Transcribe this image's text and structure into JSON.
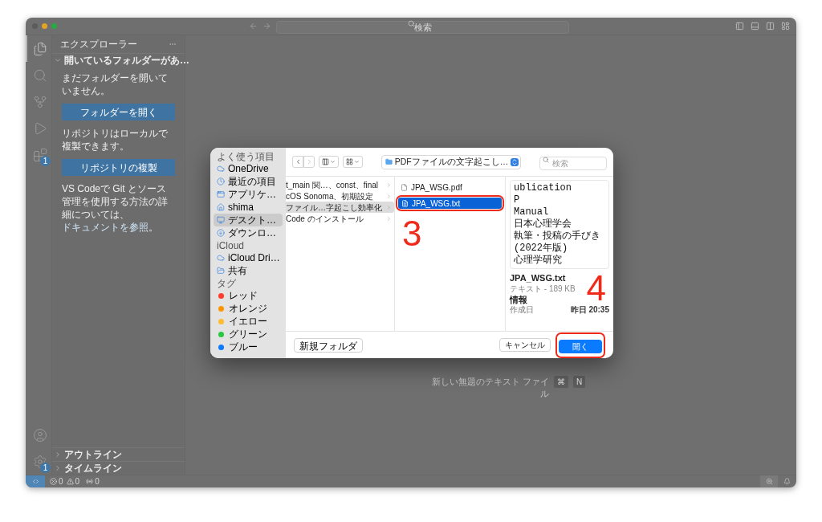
{
  "titlebar": {
    "search_placeholder": "検索"
  },
  "activity_bar": {
    "items": [
      {
        "kind": "explorer",
        "selected": true
      },
      {
        "kind": "search",
        "selected": false
      },
      {
        "kind": "source-control",
        "selected": false
      },
      {
        "kind": "run",
        "selected": false
      },
      {
        "kind": "extensions",
        "selected": false,
        "badge": "1"
      }
    ],
    "bottom": [
      {
        "kind": "account"
      },
      {
        "kind": "settings",
        "badge": "1"
      }
    ]
  },
  "sidebar": {
    "title": "エクスプローラー",
    "section": {
      "title": "開いているフォルダーがあ…",
      "expanded": true
    },
    "message_1": "まだフォルダーを開いていません。",
    "open_folder_button": "フォルダーを開く",
    "message_2": "リポジトリはローカルで複製できます。",
    "clone_button": "リポジトリの複製",
    "message_3": "VS Codeで Git とソース管理を使用する方法の詳細については、",
    "docs_link": "ドキュメントを参照",
    "message_3_end": "。",
    "bottom_sections": [
      {
        "title": "アウトライン",
        "expanded": false
      },
      {
        "title": "タイムライン",
        "expanded": false
      }
    ]
  },
  "editor": {
    "hint": {
      "label": "新しい無題のテキスト ファイル",
      "keys": [
        "⌘",
        "N"
      ]
    }
  },
  "status_bar": {
    "errors": "0",
    "warnings": "0",
    "ports": "0"
  },
  "dialog": {
    "sidebar": [
      {
        "title": "よく使う項目",
        "items": [
          {
            "kind": "cloud",
            "label": "OneDrive",
            "selected": false
          },
          {
            "kind": "clock",
            "label": "最近の項目",
            "selected": false
          },
          {
            "kind": "apps",
            "label": "アプリケ…",
            "selected": false
          },
          {
            "kind": "home",
            "label": "shima",
            "selected": false
          },
          {
            "kind": "desktop",
            "label": "デスクト…",
            "selected": true
          },
          {
            "kind": "download",
            "label": "ダウンロ…",
            "selected": false
          }
        ]
      },
      {
        "title": "iCloud",
        "items": [
          {
            "kind": "cloud",
            "label": "iCloud Dri…",
            "selected": false
          },
          {
            "kind": "shared",
            "label": "共有",
            "selected": false
          }
        ]
      },
      {
        "title": "タグ",
        "items": [
          {
            "kind": "tag",
            "label": "レッド",
            "color": "#ff3b30",
            "selected": false
          },
          {
            "kind": "tag",
            "label": "オレンジ",
            "color": "#ff9500",
            "selected": false
          },
          {
            "kind": "tag",
            "label": "イエロー",
            "color": "#febc2e",
            "selected": false
          },
          {
            "kind": "tag",
            "label": "グリーン",
            "color": "#28c840",
            "selected": false
          },
          {
            "kind": "tag",
            "label": "ブルー",
            "color": "#0a7aff",
            "selected": false
          }
        ]
      }
    ],
    "location": "PDFファイルの文字起こし…",
    "search_placeholder": "検索",
    "folders": [
      {
        "label": "t_main 関…、const、final",
        "selected": false
      },
      {
        "label": "cOS Sonoma、初期設定",
        "selected": false
      },
      {
        "label": "ファイル…字起こし効率化",
        "selected": true
      },
      {
        "label": "Code のインストール",
        "selected": false
      }
    ],
    "files": [
      {
        "kind": "pdf",
        "label": "JPA_WSG.pdf",
        "selected": false,
        "circled": false
      },
      {
        "kind": "text",
        "label": "JPA_WSG.txt",
        "selected": true,
        "circled": true
      }
    ],
    "file_annotation": "3",
    "preview_lines": [
      "ublication",
      "P",
      "Manual",
      "日本心理学会",
      "執筆・投稿の手びき",
      "(2022年版)",
      "心理学研究"
    ],
    "info": {
      "name": "JPA_WSG.txt",
      "type": "テキスト - 189 KB",
      "heading": "情報",
      "rows": [
        {
          "label": "作成日",
          "value": "昨日 20:35"
        }
      ]
    },
    "button_annotation": "4",
    "new_folder_button": "新規フォルダ",
    "cancel_button": "キャンセル",
    "open_button": {
      "label": "開く",
      "circled": true
    }
  }
}
